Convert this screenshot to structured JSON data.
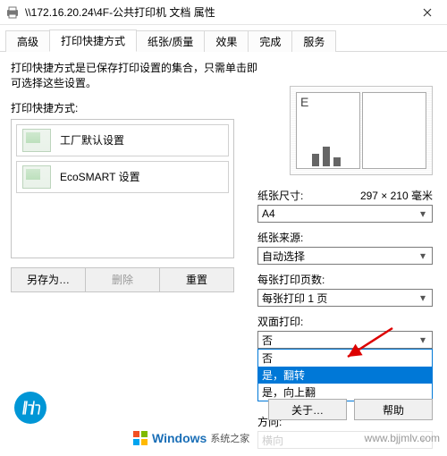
{
  "title": "\\\\172.16.20.24\\4F-公共打印机 文档 属性",
  "tabs": [
    "高级",
    "打印快捷方式",
    "纸张/质量",
    "效果",
    "完成",
    "服务"
  ],
  "active_tab_index": 1,
  "description": "打印快捷方式是已保存打印设置的集合，只需单击即可选择这些设置。",
  "shortcut_label": "打印快捷方式:",
  "shortcuts": [
    {
      "name": "工厂默认设置"
    },
    {
      "name": "EcoSMART 设置"
    }
  ],
  "buttons": {
    "saveas": "另存为…",
    "delete": "删除",
    "reset": "重置"
  },
  "preview_letter": "E",
  "fields": {
    "paper_size": {
      "label": "纸张尺寸:",
      "extra": "297 × 210 毫米",
      "value": "A4"
    },
    "paper_source": {
      "label": "纸张来源:",
      "value": "自动选择"
    },
    "pages_per_sheet": {
      "label": "每张打印页数:",
      "value": "每张打印 1 页"
    },
    "duplex": {
      "label": "双面打印:",
      "value": "否",
      "options": [
        "否",
        "是，翻转",
        "是，向上翻"
      ],
      "highlight_index": 1
    },
    "orientation": {
      "label": "方向:",
      "value": "横向"
    }
  },
  "footer": {
    "about": "关于…",
    "help": "帮助"
  },
  "watermark": {
    "brand1": "Windows",
    "brand2": "系统之家",
    "url": "www.bjjmlv.com"
  }
}
